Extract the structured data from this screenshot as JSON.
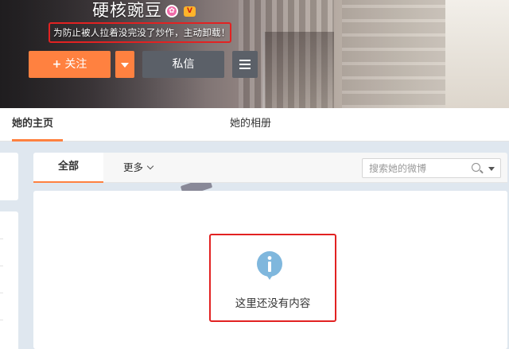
{
  "profile": {
    "username": "硬核豌豆",
    "intro": "为防止被人拉着没完没了炒作，主动卸载！"
  },
  "actions": {
    "follow_label": "关注",
    "message_label": "私信"
  },
  "tabs": [
    {
      "label": "她的主页",
      "active": true
    },
    {
      "label": "她的相册",
      "active": false
    }
  ],
  "feed": {
    "tabs": [
      {
        "label": "全部",
        "active": true
      },
      {
        "label": "更多"
      }
    ],
    "search_placeholder": "搜索她的微博",
    "empty_message": "这里还没有内容"
  },
  "colors": {
    "accent": "#ff8140",
    "dark_button": "#5b6068",
    "highlight_box": "#e22222",
    "info_icon": "#7fb7dd"
  },
  "icons": {
    "badge": "flower-badge-icon",
    "vip": "vip-icon",
    "menu": "hamburger-icon",
    "search": "search-icon",
    "info": "info-icon"
  }
}
